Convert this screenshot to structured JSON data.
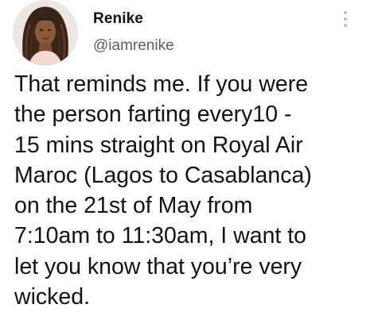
{
  "user": {
    "display_name": "Renike",
    "handle": "@iamrenike",
    "avatar_icon": "profile-photo"
  },
  "menu": {
    "icon": "more-options-vertical-icon"
  },
  "tweet": {
    "lines": [
      "That reminds me. If you were",
      "the person farting every10 -",
      "15 mins straight on Royal Air",
      "Maroc (Lagos to Casablanca)",
      "on the 21st of May from",
      "7:10am to 11:30am, I want to",
      "let you know that you’re very",
      "wicked."
    ]
  }
}
